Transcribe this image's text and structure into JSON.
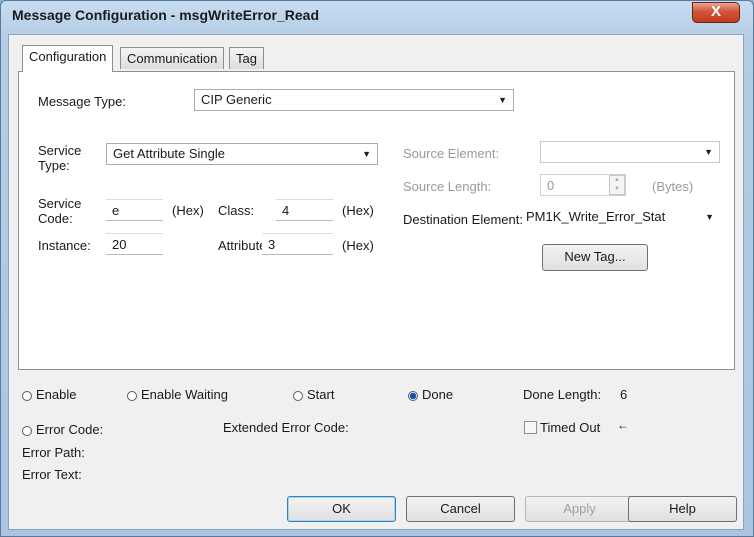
{
  "window": {
    "title": "Message Configuration - msgWriteError_Read",
    "close_glyph": "X"
  },
  "tabs": [
    {
      "label": "Configuration",
      "active": true
    },
    {
      "label": "Communication",
      "active": false
    },
    {
      "label": "Tag",
      "active": false
    }
  ],
  "config": {
    "message_type_label": "Message Type:",
    "message_type_value": "CIP Generic",
    "service_type_label_1": "Service",
    "service_type_label_2": "Type:",
    "service_type_value": "Get Attribute Single",
    "service_code_label_1": "Service",
    "service_code_label_2": "Code:",
    "service_code_value": "e",
    "hex_label": "(Hex)",
    "class_label": "Class:",
    "class_value": "4",
    "instance_label": "Instance:",
    "instance_value": "20",
    "attribute_label": "Attribute:",
    "attribute_value": "3",
    "source_element_label": "Source Element:",
    "source_element_value": "",
    "source_length_label": "Source Length:",
    "source_length_value": "0",
    "bytes_label": "(Bytes)",
    "destination_label": "Destination Element:",
    "destination_value": "PM1K_Write_Error_Stat",
    "new_tag_label": "New Tag..."
  },
  "status": {
    "enable": "Enable",
    "enable_waiting": "Enable Waiting",
    "start": "Start",
    "done": "Done",
    "done_selected": true,
    "done_length_label": "Done Length:",
    "done_length_value": "6",
    "error_code": "Error Code:",
    "extended_error_code": "Extended Error Code:",
    "timed_out": "Timed Out",
    "timed_out_arrow": "←",
    "error_path": "Error Path:",
    "error_text": "Error Text:"
  },
  "buttons": {
    "ok": "OK",
    "cancel": "Cancel",
    "apply": "Apply",
    "help": "Help"
  }
}
